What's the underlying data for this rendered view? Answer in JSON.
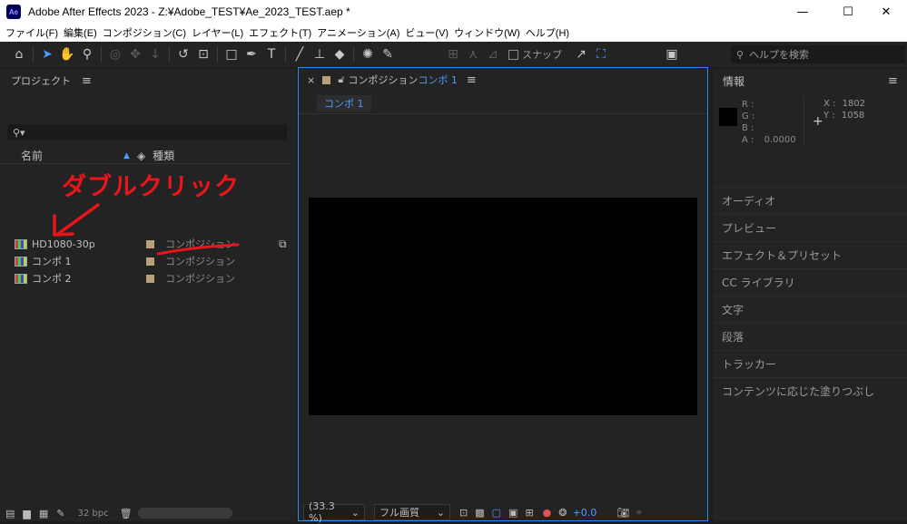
{
  "titlebar": {
    "app_icon": "Ae",
    "title": "Adobe After Effects 2023 - Z:¥Adobe_TEST¥Ae_2023_TEST.aep *",
    "minimize": "—",
    "maximize": "☐",
    "close": "✕"
  },
  "menu": [
    "ファイル(F)",
    "編集(E)",
    "コンポジション(C)",
    "レイヤー(L)",
    "エフェクト(T)",
    "アニメーション(A)",
    "ビュー(V)",
    "ウィンドウ(W)",
    "ヘルプ(H)"
  ],
  "toolbar": {
    "snap_label": "スナップ",
    "help_search_placeholder": "ヘルプを検索"
  },
  "project": {
    "title": "プロジェクト",
    "menu_icon": "≡",
    "col_name": "名前",
    "col_type": "種類",
    "items": [
      {
        "name": "HD1080-30p",
        "type": "コンポジション"
      },
      {
        "name": "コンポ 1",
        "type": "コンポジション"
      },
      {
        "name": "コンポ 2",
        "type": "コンポジション"
      }
    ],
    "bpc": "32 bpc"
  },
  "annotation": {
    "text": "ダブルクリック",
    "color": "#e8151b"
  },
  "composition": {
    "panel_prefix": "コンポジション",
    "panel_name": "コンポ 1",
    "tab": "コンポ 1",
    "zoom": "(33.3 %)",
    "quality": "フル画質",
    "exposure": "+0.0"
  },
  "info": {
    "title": "情報",
    "r_label": "R :",
    "g_label": "G :",
    "b_label": "B :",
    "a_label": "A :",
    "a_value": "0.0000",
    "x_label": "X :",
    "x_value": "1802",
    "y_label": "Y :",
    "y_value": "1058",
    "panels": [
      "オーディオ",
      "プレビュー",
      "エフェクト＆プリセット",
      "CC ライブラリ",
      "文字",
      "段落",
      "トラッカー",
      "コンテンツに応じた塗りつぶし"
    ]
  },
  "colors": {
    "accent": "#2d8ceb",
    "label_swatch": "#b8a07a"
  }
}
